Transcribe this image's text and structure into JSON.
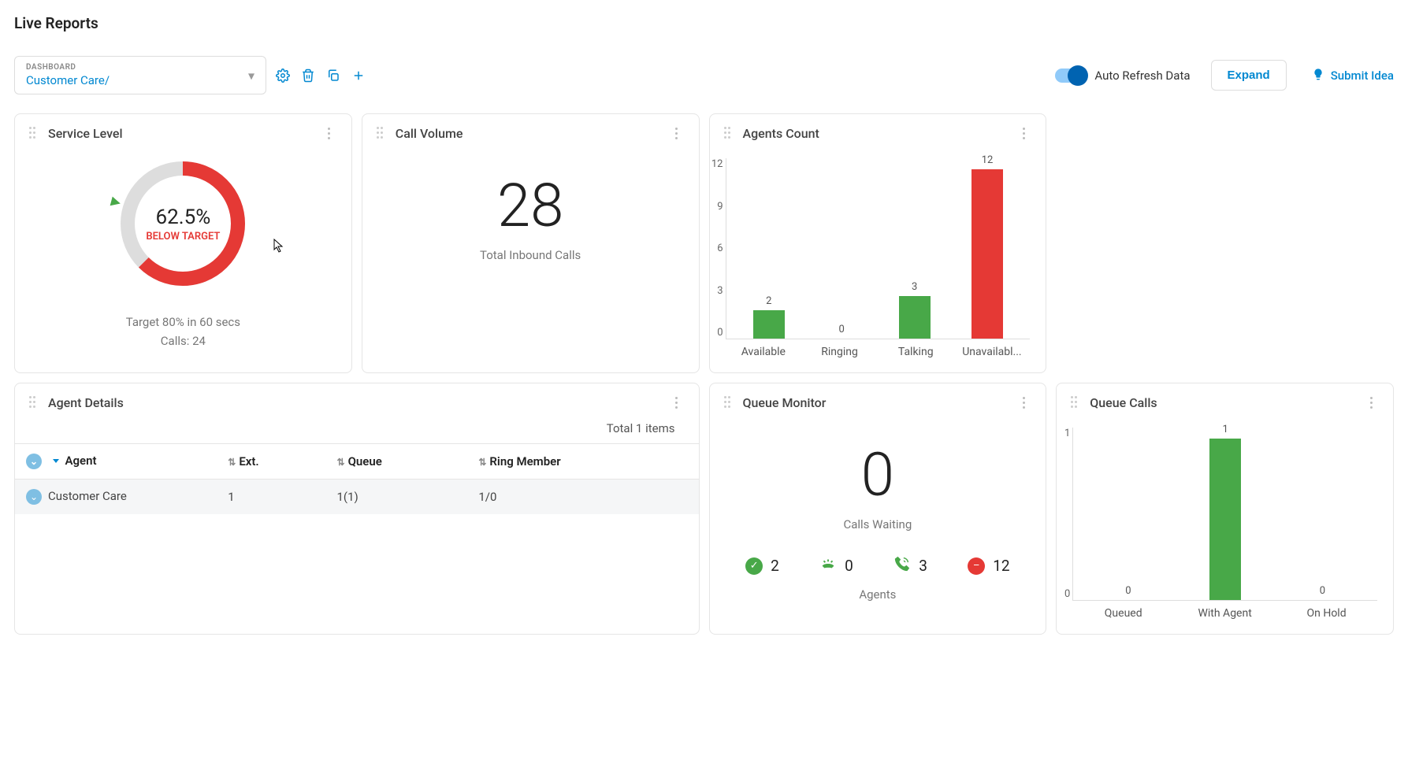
{
  "page": {
    "title": "Live Reports"
  },
  "dashboardSelect": {
    "label": "DASHBOARD",
    "value": "Customer Care/"
  },
  "autoRefresh": {
    "label": "Auto Refresh Data",
    "on": true
  },
  "expand": {
    "label": "Expand"
  },
  "submitIdea": {
    "label": "Submit Idea"
  },
  "serviceLevel": {
    "title": "Service Level",
    "percent": "62.5%",
    "status": "BELOW TARGET",
    "targetLine": "Target 80% in 60 secs",
    "callsLine": "Calls: 24",
    "fillFraction": 0.625
  },
  "callVolume": {
    "title": "Call Volume",
    "value": "28",
    "label": "Total Inbound Calls"
  },
  "agentsCount": {
    "title": "Agents Count",
    "yTicks": [
      "12",
      "9",
      "6",
      "3",
      "0"
    ],
    "chart_data": {
      "type": "bar",
      "categories": [
        "Available",
        "Ringing",
        "Talking",
        "Unavailabl..."
      ],
      "values": [
        2,
        0,
        3,
        12
      ],
      "colors": [
        "green",
        "green",
        "green",
        "red"
      ],
      "ylim": [
        0,
        12
      ]
    }
  },
  "agentDetails": {
    "title": "Agent Details",
    "totalItems": "Total 1 items",
    "columns": {
      "agent": "Agent",
      "ext": "Ext.",
      "queue": "Queue",
      "ringMember": "Ring Member"
    },
    "rows": [
      {
        "agent": "Customer Care",
        "ext": "1",
        "queue": "1(1)",
        "ringMember": "1/0"
      }
    ]
  },
  "queueMonitor": {
    "title": "Queue Monitor",
    "value": "0",
    "label": "Calls Waiting",
    "agentsLabel": "Agents",
    "stats": {
      "available": 2,
      "ringing": 0,
      "talking": 3,
      "unavailable": 12
    }
  },
  "queueCalls": {
    "title": "Queue Calls",
    "yTicks": [
      "1",
      "0"
    ],
    "chart_data": {
      "type": "bar",
      "categories": [
        "Queued",
        "With Agent",
        "On Hold"
      ],
      "values": [
        0,
        1,
        0
      ],
      "colors": [
        "green",
        "green",
        "green"
      ],
      "ylim": [
        0,
        1
      ]
    }
  },
  "chart_data": [
    {
      "type": "bar",
      "title": "Agents Count",
      "categories": [
        "Available",
        "Ringing",
        "Talking",
        "Unavailable"
      ],
      "values": [
        2,
        0,
        3,
        12
      ],
      "ylim": [
        0,
        12
      ]
    },
    {
      "type": "bar",
      "title": "Queue Calls",
      "categories": [
        "Queued",
        "With Agent",
        "On Hold"
      ],
      "values": [
        0,
        1,
        0
      ],
      "ylim": [
        0,
        1
      ]
    }
  ]
}
